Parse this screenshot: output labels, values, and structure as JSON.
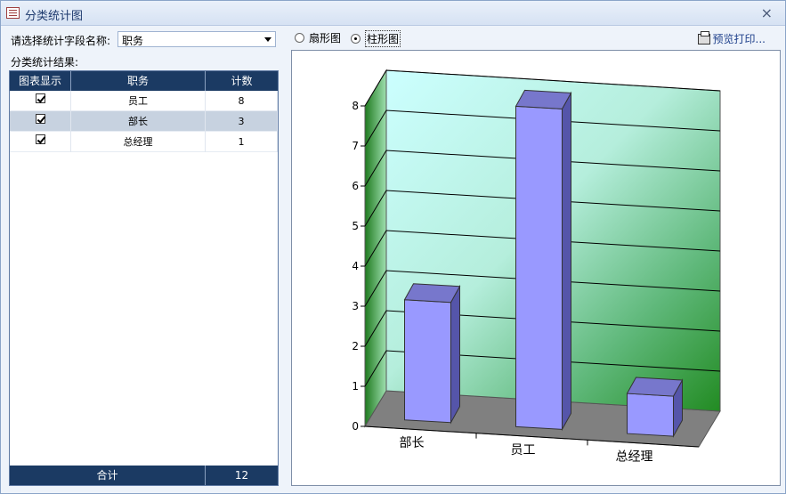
{
  "window": {
    "title": "分类统计图",
    "close_label": "×"
  },
  "field": {
    "label": "请选择统计字段名称:",
    "value": "职务"
  },
  "result_label": "分类统计结果:",
  "table": {
    "headers": [
      "图表显示",
      "职务",
      "计数"
    ],
    "rows": [
      {
        "show": true,
        "name": "员工",
        "count": "8"
      },
      {
        "show": true,
        "name": "部长",
        "count": "3"
      },
      {
        "show": true,
        "name": "总经理",
        "count": "1"
      }
    ],
    "footer_label": "合计",
    "footer_total": "12"
  },
  "chart_type_options": [
    {
      "label": "扇形图",
      "selected": false
    },
    {
      "label": "柱形图",
      "selected": true
    }
  ],
  "print_label": "预览打印...",
  "colors": {
    "bar": "#9999ff",
    "wall_light": "#ccffff",
    "wall_dark": "#228b22",
    "floor": "#808080"
  },
  "chart_data": {
    "type": "bar",
    "categories": [
      "部长",
      "员工",
      "总经理"
    ],
    "values": [
      3,
      8,
      1
    ],
    "ylim": [
      0,
      8
    ],
    "yticks": [
      "0",
      "1",
      "2",
      "3",
      "4",
      "5",
      "6",
      "7",
      "8"
    ],
    "grid": true
  }
}
